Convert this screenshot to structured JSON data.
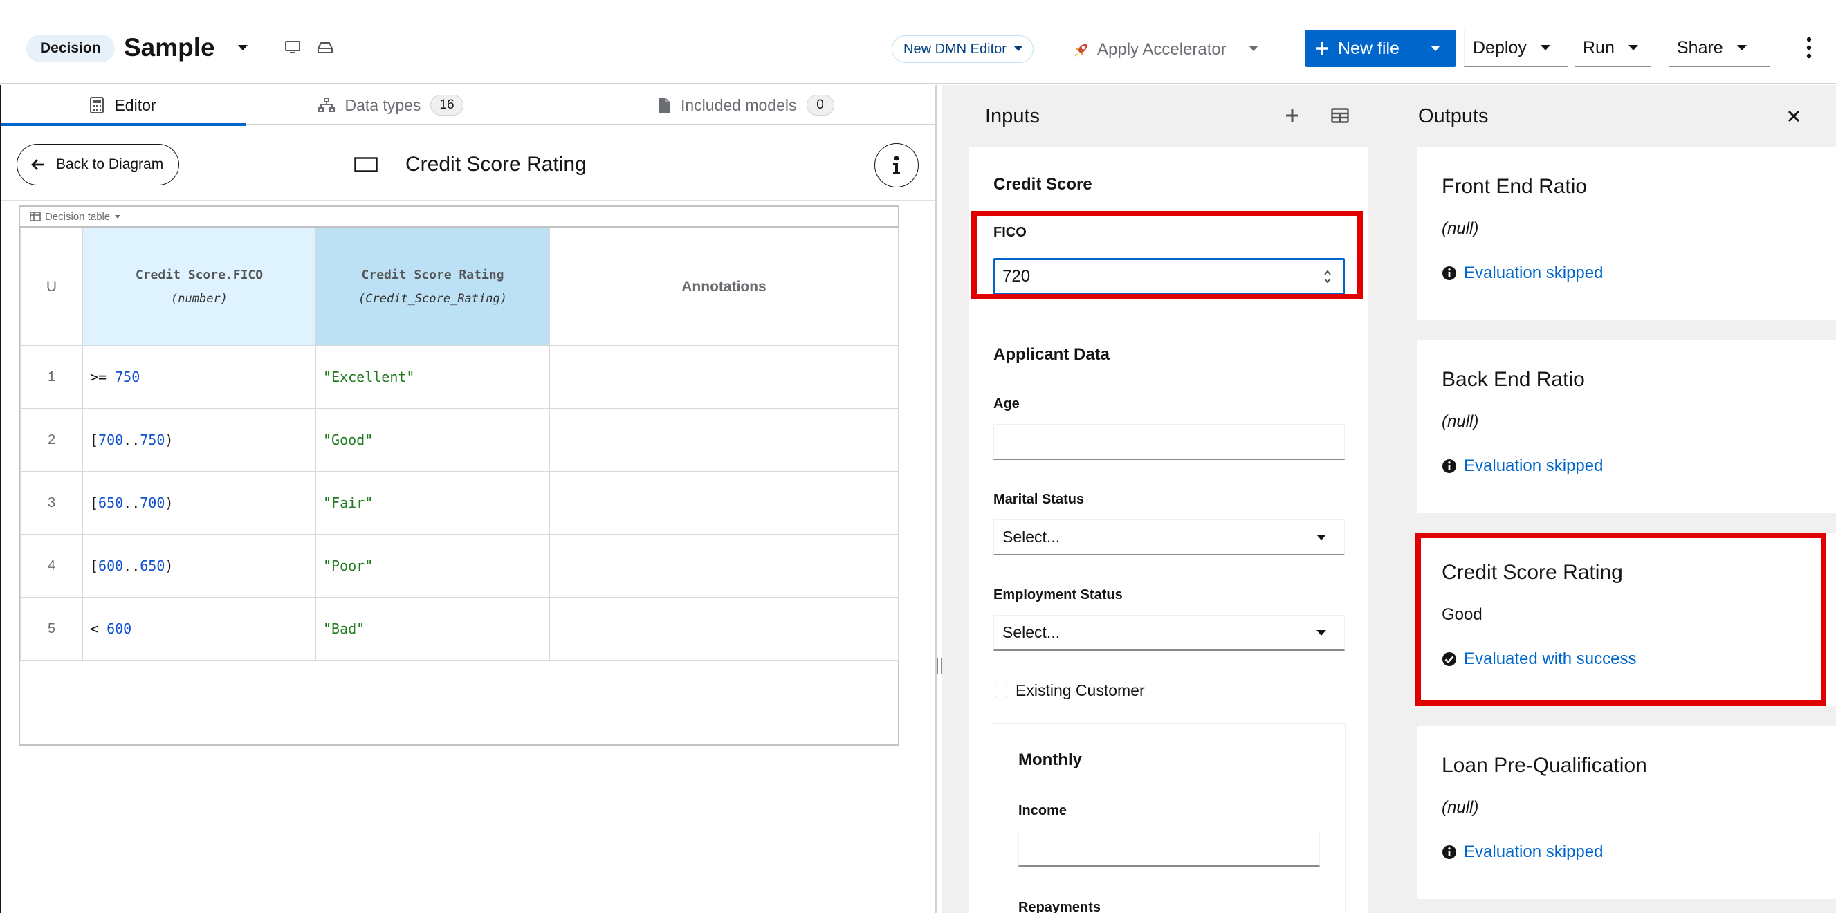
{
  "header": {
    "kind_badge": "Decision",
    "file_name": "Sample",
    "editor_switch": "New DMN Editor",
    "accelerator": "Apply Accelerator",
    "new_file": "New file",
    "deploy": "Deploy",
    "run": "Run",
    "share": "Share"
  },
  "editor": {
    "tabs": [
      {
        "label": "Editor"
      },
      {
        "label": "Data types",
        "count": "16"
      },
      {
        "label": "Included models",
        "count": "0"
      }
    ],
    "back_button": "Back to Diagram",
    "decision_title": "Credit Score Rating",
    "expression_type": "Decision table",
    "table": {
      "hit_policy": "U",
      "input_header": {
        "name": "Credit Score.FICO",
        "type": "(number)"
      },
      "output_header": {
        "name": "Credit Score Rating",
        "type": "(Credit_Score_Rating)"
      },
      "annotations_header": "Annotations",
      "rows": [
        {
          "num": "1",
          "op": ">= ",
          "a": "750",
          "dots": "",
          "b": "",
          "close": "",
          "out": "\"Excellent\""
        },
        {
          "num": "2",
          "op": "[",
          "a": "700",
          "dots": "..",
          "b": "750",
          "close": ")",
          "out": "\"Good\""
        },
        {
          "num": "3",
          "op": "[",
          "a": "650",
          "dots": "..",
          "b": "700",
          "close": ")",
          "out": "\"Fair\""
        },
        {
          "num": "4",
          "op": "[",
          "a": "600",
          "dots": "..",
          "b": "650",
          "close": ")",
          "out": "\"Poor\""
        },
        {
          "num": "5",
          "op": "< ",
          "a": "600",
          "dots": "",
          "b": "",
          "close": "",
          "out": "\"Bad\""
        }
      ]
    }
  },
  "inputs": {
    "title": "Inputs",
    "credit_score_section": "Credit Score",
    "fico_label": "FICO",
    "fico_value": "720",
    "applicant_section": "Applicant Data",
    "age_label": "Age",
    "marital_label": "Marital Status",
    "marital_value": "Select...",
    "employment_label": "Employment Status",
    "employment_value": "Select...",
    "existing_customer_label": "Existing Customer",
    "monthly_section": "Monthly",
    "income_label": "Income",
    "repayments_label": "Repayments"
  },
  "outputs": {
    "title": "Outputs",
    "cards": [
      {
        "title": "Front End Ratio",
        "value": "(null)",
        "status": "Evaluation skipped"
      },
      {
        "title": "Back End Ratio",
        "value": "(null)",
        "status": "Evaluation skipped"
      },
      {
        "title": "Credit Score Rating",
        "value": "Good",
        "status": "Evaluated with success"
      },
      {
        "title": "Loan Pre-Qualification",
        "value": "(null)",
        "status": "Evaluation skipped"
      }
    ]
  },
  "colors": {
    "primary_blue": "#0066cc",
    "highlight_red": "#e00000",
    "input_header_bg": "#def3ff",
    "output_header_bg": "#bde1f4"
  }
}
